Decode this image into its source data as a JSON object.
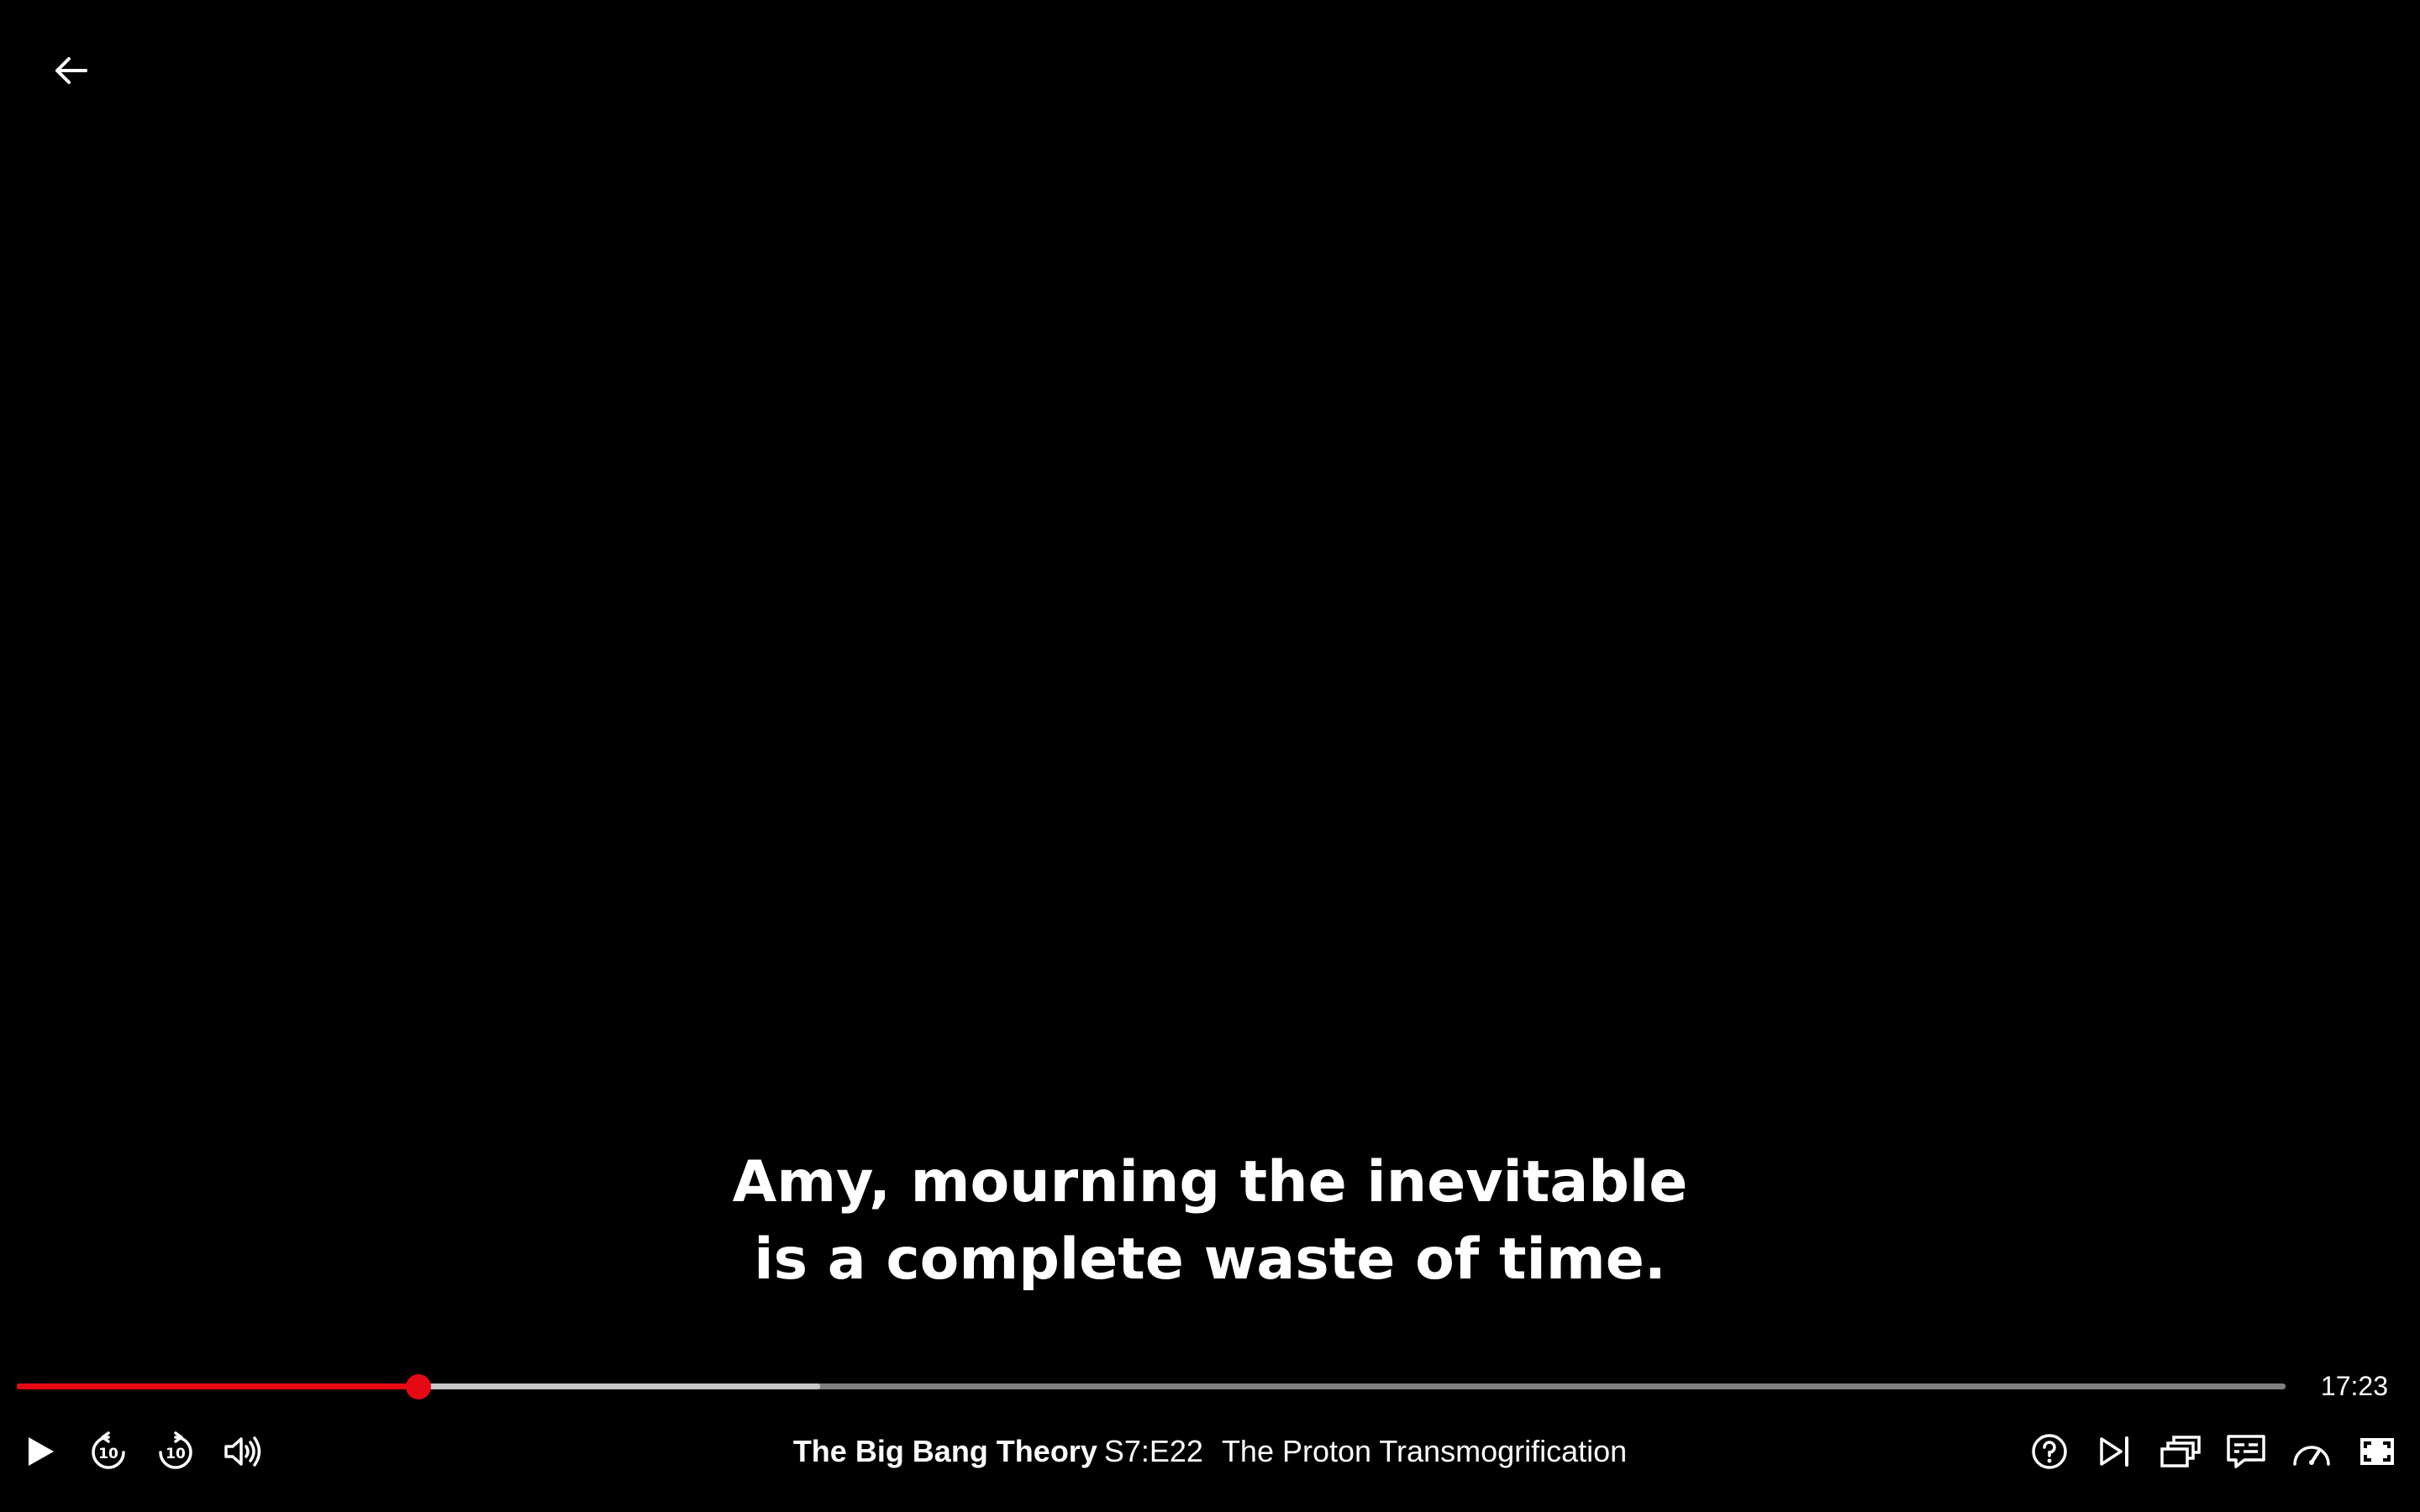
{
  "player": {
    "subtitle_lines": [
      "Amy, mourning the inevitable",
      "is a complete waste of time."
    ],
    "progress": {
      "played_fraction": 0.177,
      "buffered_fraction": 0.354,
      "played_color": "#e50914",
      "buffered_color": "#c8c8c8",
      "track_color": "#808080"
    },
    "time_remaining": "17:23",
    "show_title": "The Big Bang Theory",
    "episode_code": "S7:E22",
    "episode_title": "The Proton Transmogrification",
    "icons": {
      "back": "arrow-left-icon",
      "play": "play-icon",
      "rewind": "rewind-10-icon",
      "forward": "forward-10-icon",
      "volume": "volume-icon",
      "help": "help-icon",
      "next": "next-episode-icon",
      "episodes": "episodes-icon",
      "subtitles": "subtitles-icon",
      "speed": "playback-speed-icon",
      "fullscreen": "fullscreen-icon"
    },
    "rewind_seconds": "10",
    "forward_seconds": "10"
  }
}
